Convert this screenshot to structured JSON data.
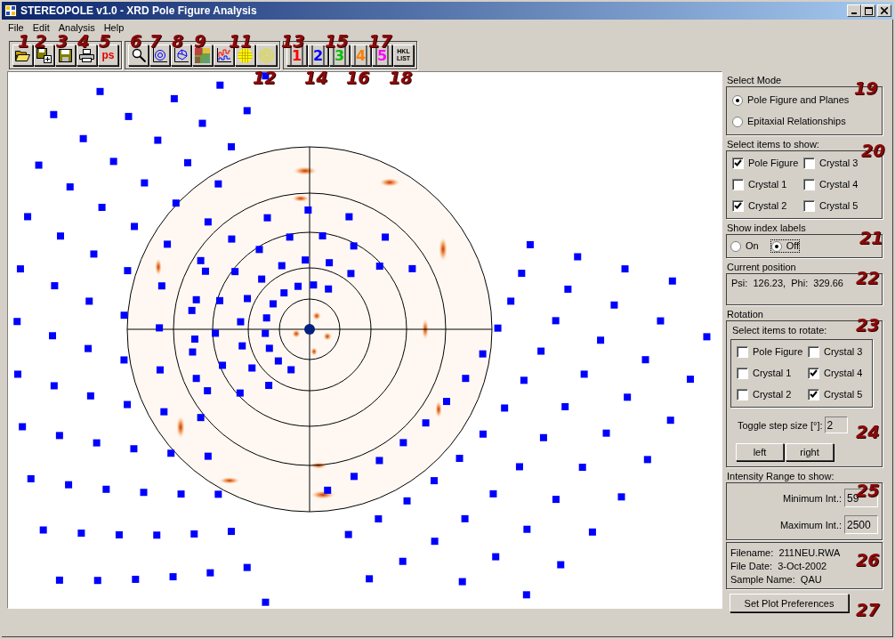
{
  "window": {
    "title": "STEREOPOLE v1.0 - XRD Pole Figure Analysis"
  },
  "menu": [
    "File",
    "Edit",
    "Analysis",
    "Help"
  ],
  "toolbar": [
    [
      {
        "kind": "open"
      },
      {
        "kind": "save-as"
      },
      {
        "kind": "save"
      },
      {
        "kind": "print"
      },
      {
        "kind": "ps",
        "label": "ps"
      }
    ],
    [
      {
        "kind": "zoom"
      },
      {
        "kind": "polar"
      },
      {
        "kind": "crystal"
      },
      {
        "kind": "colormap"
      },
      {
        "kind": "histogram"
      },
      {
        "kind": "grid"
      },
      {
        "kind": "rings"
      }
    ],
    [
      {
        "kind": "crystal-number",
        "label": "1",
        "color": "#ff0000"
      },
      {
        "kind": "crystal-number",
        "label": "2",
        "color": "#0000ff"
      },
      {
        "kind": "crystal-number",
        "label": "3",
        "color": "#00c000"
      },
      {
        "kind": "crystal-number",
        "label": "4",
        "color": "#ff8000"
      },
      {
        "kind": "crystal-number",
        "label": "5",
        "color": "#ff00ff"
      },
      {
        "kind": "hkl",
        "label": "HKL LIST"
      }
    ]
  ],
  "callouts": [
    "1",
    "2",
    "3",
    "4",
    "5",
    "6",
    "7",
    "8",
    "9",
    "11",
    "12",
    "13",
    "14",
    "15",
    "16",
    "17",
    "18",
    "19",
    "20",
    "21",
    "22",
    "23",
    "24",
    "25",
    "26",
    "27"
  ],
  "select_mode": {
    "label": "Select Mode",
    "options": [
      {
        "label": "Pole Figure and Planes",
        "selected": true
      },
      {
        "label": "Epitaxial Relationships",
        "selected": false
      }
    ]
  },
  "show_items": {
    "label": "Select items to show:",
    "items": [
      {
        "label": "Pole Figure",
        "checked": true
      },
      {
        "label": "Crystal 3",
        "checked": false
      },
      {
        "label": "Crystal 1",
        "checked": false
      },
      {
        "label": "Crystal 4",
        "checked": false
      },
      {
        "label": "Crystal 2",
        "checked": true
      },
      {
        "label": "Crystal 5",
        "checked": false
      }
    ]
  },
  "index_labels": {
    "label": "Show index labels",
    "options": [
      {
        "label": "On",
        "selected": false
      },
      {
        "label": "Off",
        "selected": true
      }
    ]
  },
  "current_position": {
    "label": "Current position",
    "text": "Psi:  126.23,  Phi:  329.66"
  },
  "rotation": {
    "label": "Rotation",
    "sub_label": "Select items to rotate:",
    "items": [
      {
        "label": "Pole Figure",
        "checked": false
      },
      {
        "label": "Crystal 3",
        "checked": false
      },
      {
        "label": "Crystal 1",
        "checked": false
      },
      {
        "label": "Crystal 4",
        "checked": true
      },
      {
        "label": "Crystal 2",
        "checked": false
      },
      {
        "label": "Crystal 5",
        "checked": true
      }
    ],
    "step_label": "Toggle step size [°]:",
    "step_value": "2",
    "buttons": [
      "left",
      "right"
    ]
  },
  "intensity": {
    "label": "Intensity Range to show:",
    "fields": [
      {
        "label": "Minimum Int.:",
        "value": "59"
      },
      {
        "label": "Maximum Int.:",
        "value": "2500"
      }
    ]
  },
  "file_info": [
    "Filename:  211NEU.RWA",
    "File Date:  3-Oct-2002",
    "Sample Name:  QAU"
  ],
  "preferences_button": "Set Plot Preferences"
}
